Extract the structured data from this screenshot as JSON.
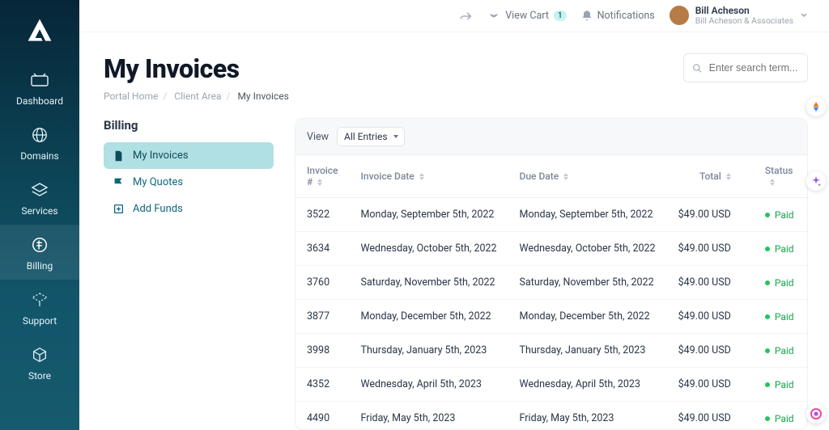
{
  "sidebar": {
    "items": [
      {
        "label": "Dashboard"
      },
      {
        "label": "Domains"
      },
      {
        "label": "Services"
      },
      {
        "label": "Billing"
      },
      {
        "label": "Support"
      },
      {
        "label": "Store"
      }
    ]
  },
  "header": {
    "view_cart": "View Cart",
    "cart_count": "1",
    "notifications": "Notifications",
    "user_name": "Bill Acheson",
    "user_sub": "Bill Acheson & Associates"
  },
  "page": {
    "title": "My Invoices",
    "crumb1": "Portal Home",
    "crumb2": "Client Area",
    "crumb3": "My Invoices"
  },
  "search": {
    "placeholder": "Enter search term..."
  },
  "billing_side": {
    "heading": "Billing",
    "items": [
      {
        "label": "My Invoices"
      },
      {
        "label": "My Quotes"
      },
      {
        "label": "Add Funds"
      }
    ]
  },
  "panel": {
    "view_label": "View",
    "view_value": "All Entries"
  },
  "columns": {
    "invoice": "Invoice #",
    "date": "Invoice Date",
    "due": "Due Date",
    "total": "Total",
    "status": "Status"
  },
  "rows": [
    {
      "id": "3522",
      "date": "Monday, September 5th, 2022",
      "due": "Monday, September 5th, 2022",
      "total": "$49.00 USD",
      "status": "Paid"
    },
    {
      "id": "3634",
      "date": "Wednesday, October 5th, 2022",
      "due": "Wednesday, October 5th, 2022",
      "total": "$49.00 USD",
      "status": "Paid"
    },
    {
      "id": "3760",
      "date": "Saturday, November 5th, 2022",
      "due": "Saturday, November 5th, 2022",
      "total": "$49.00 USD",
      "status": "Paid"
    },
    {
      "id": "3877",
      "date": "Monday, December 5th, 2022",
      "due": "Monday, December 5th, 2022",
      "total": "$49.00 USD",
      "status": "Paid"
    },
    {
      "id": "3998",
      "date": "Thursday, January 5th, 2023",
      "due": "Thursday, January 5th, 2023",
      "total": "$49.00 USD",
      "status": "Paid"
    },
    {
      "id": "4352",
      "date": "Wednesday, April 5th, 2023",
      "due": "Wednesday, April 5th, 2023",
      "total": "$49.00 USD",
      "status": "Paid"
    },
    {
      "id": "4490",
      "date": "Friday, May 5th, 2023",
      "due": "Friday, May 5th, 2023",
      "total": "$49.00 USD",
      "status": "Paid"
    }
  ]
}
